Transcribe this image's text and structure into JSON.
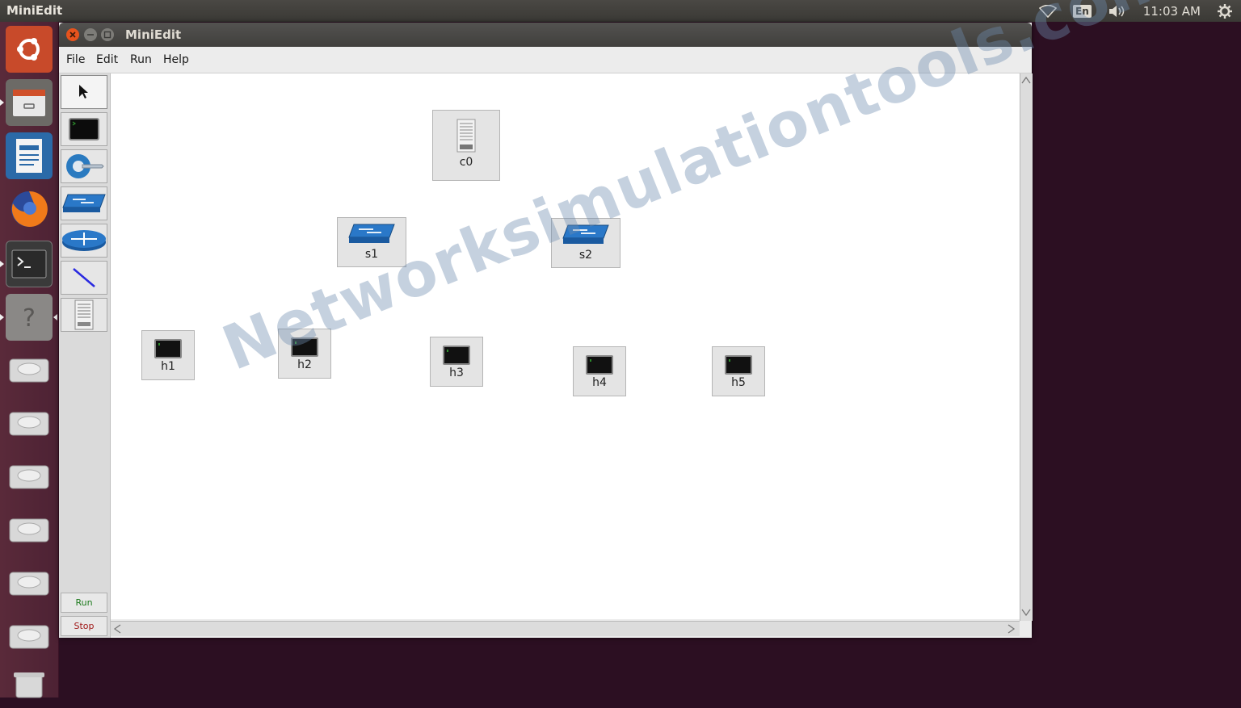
{
  "top_panel": {
    "app_title": "MiniEdit",
    "keyboard_layout": "En",
    "clock": "11:03 AM"
  },
  "launcher": {
    "items": [
      "ubuntu-dash-icon",
      "files-icon",
      "writer-icon",
      "firefox-icon",
      "terminal-icon",
      "help-icon",
      "drive-icon",
      "drive-icon",
      "drive-icon",
      "drive-icon",
      "drive-icon",
      "drive-icon",
      "trash-icon"
    ]
  },
  "window": {
    "title": "MiniEdit",
    "menu": [
      "File",
      "Edit",
      "Run",
      "Help"
    ]
  },
  "toolbar": {
    "tools": [
      "select-tool",
      "host-tool",
      "controller-tool",
      "switch-tool",
      "router-tool",
      "link-tool",
      "netlink-tool"
    ],
    "run_label": "Run",
    "stop_label": "Stop"
  },
  "canvas": {
    "nodes": [
      {
        "id": "c0",
        "type": "controller",
        "label": "c0"
      },
      {
        "id": "s1",
        "type": "switch",
        "label": "s1"
      },
      {
        "id": "s2",
        "type": "switch",
        "label": "s2"
      },
      {
        "id": "h1",
        "type": "host",
        "label": "h1"
      },
      {
        "id": "h2",
        "type": "host",
        "label": "h2"
      },
      {
        "id": "h3",
        "type": "host",
        "label": "h3"
      },
      {
        "id": "h4",
        "type": "host",
        "label": "h4"
      },
      {
        "id": "h5",
        "type": "host",
        "label": "h5"
      }
    ],
    "watermark": "Networksimulationtools.com"
  },
  "colors": {
    "launcher_bg": "#5a2a3a",
    "desktop_bg": "#2c0f22",
    "run_text": "#1d7a1d",
    "stop_text": "#a01818",
    "close_btn": "#e6531d"
  }
}
